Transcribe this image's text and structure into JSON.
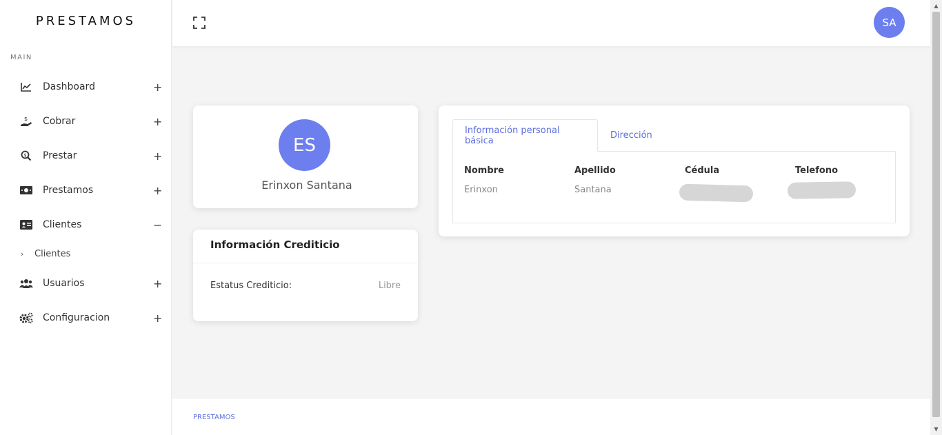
{
  "brand": "PRESTAMOS",
  "sidebar": {
    "section_label": "MAIN",
    "items": [
      {
        "label": "Dashboard",
        "icon": "chart-line-icon",
        "toggle": "+"
      },
      {
        "label": "Cobrar",
        "icon": "hand-money-icon",
        "toggle": "+"
      },
      {
        "label": "Prestar",
        "icon": "search-dollar-icon",
        "toggle": "+"
      },
      {
        "label": "Prestamos",
        "icon": "money-bill-icon",
        "toggle": "+"
      },
      {
        "label": "Clientes",
        "icon": "id-card-icon",
        "toggle": "−"
      },
      {
        "label": "Usuarios",
        "icon": "users-icon",
        "toggle": "+"
      },
      {
        "label": "Configuracion",
        "icon": "cogs-icon",
        "toggle": "+"
      }
    ],
    "sub_item": {
      "label": "Clientes",
      "chevron": "›"
    }
  },
  "header": {
    "fullscreen_icon": "expand-icon",
    "user_initials": "SA"
  },
  "profile": {
    "initials": "ES",
    "name": "Erinxon Santana"
  },
  "credit": {
    "title": "Información Crediticio",
    "status_label": "Estatus Crediticio:",
    "status_value": "Libre"
  },
  "info": {
    "tabs": [
      "Información personal básica",
      "Dirección"
    ],
    "columns": [
      {
        "header": "Nombre",
        "value": "Erinxon"
      },
      {
        "header": "Apellido",
        "value": "Santana"
      },
      {
        "header": "Cédula",
        "value": ""
      },
      {
        "header": "Telefono",
        "value": ""
      }
    ]
  },
  "footer": {
    "text": "PRESTAMOS"
  },
  "colors": {
    "accent": "#6d7fee",
    "link": "#5c6ee0",
    "background": "#f4f4f5"
  }
}
